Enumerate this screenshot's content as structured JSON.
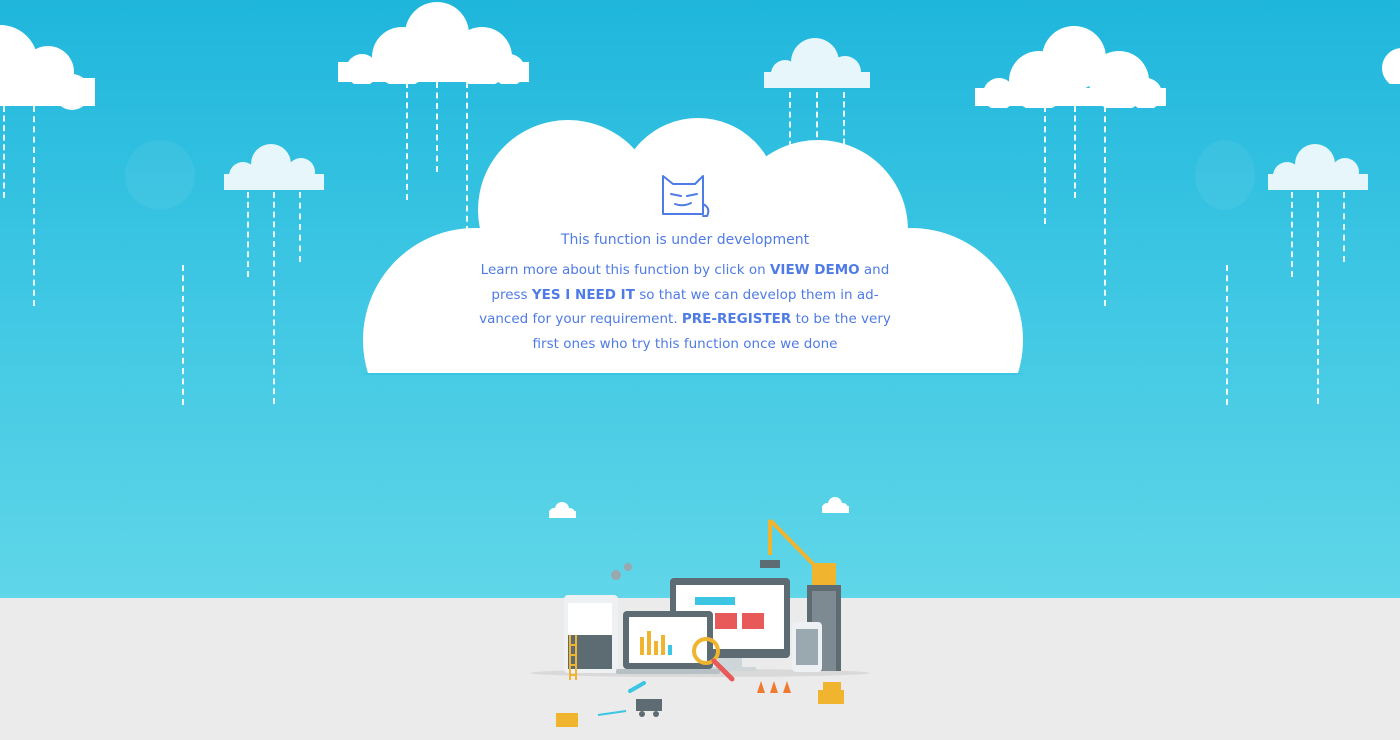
{
  "colors": {
    "sky_top": "#1fb6dc",
    "sky_bottom": "#60d6e8",
    "ground": "#ebebeb",
    "text_accent": "#4f7be6",
    "cloud": "#ffffff",
    "cloud_pale": "#e6f6fb"
  },
  "icons": {
    "logo": "cat-face-icon",
    "illustration": "construction-devices-illustration"
  },
  "message": {
    "title": "This function is under development",
    "body": {
      "part1": "Learn more about this function by click on ",
      "link_view_demo": "VIEW DEMO",
      "part2": " and press ",
      "link_yes_i_need_it": "YES I NEED IT",
      "part3": " so that we can develop them in ad-vanced for your requirement. ",
      "link_pre_register": "PRE-REGISTER",
      "part4": " to be the very first ones who try this function once we done"
    }
  }
}
